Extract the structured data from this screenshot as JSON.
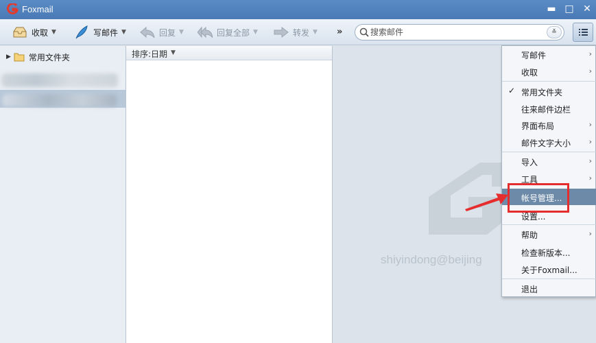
{
  "window": {
    "title": "Foxmail",
    "minimize": "▬",
    "maximize": "□",
    "close": "✕"
  },
  "toolbar": {
    "receive": {
      "label": "收取",
      "icon": "inbox-tray-icon"
    },
    "compose": {
      "label": "写邮件",
      "icon": "feather-pen-icon"
    },
    "reply": {
      "label": "回复",
      "icon": "reply-arrow-icon",
      "enabled": false
    },
    "reply_all": {
      "label": "回复全部",
      "icon": "reply-all-arrow-icon",
      "enabled": false
    },
    "forward": {
      "label": "转发",
      "icon": "forward-arrow-icon",
      "enabled": false
    },
    "more": "»",
    "caret": "▼"
  },
  "search": {
    "placeholder": "搜索邮件",
    "dropdown": "≚"
  },
  "folders": {
    "favorites": {
      "label": "常用文件夹",
      "arrow": "▶"
    }
  },
  "mail_list": {
    "sort_label": "排序:日期",
    "sort_caret": "▼"
  },
  "reading_pane": {
    "account_email": "shiyindong@beijing"
  },
  "menu": {
    "items": [
      {
        "label": "写邮件",
        "submenu": "›"
      },
      {
        "label": "收取",
        "submenu": "›"
      },
      {
        "label": "常用文件夹",
        "check": "✓"
      },
      {
        "label": "往来邮件边栏"
      },
      {
        "label": "界面布局",
        "submenu": "›"
      },
      {
        "label": "邮件文字大小",
        "submenu": "›"
      },
      {
        "label": "导入",
        "submenu": "›"
      },
      {
        "label": "工具",
        "submenu": "›"
      },
      {
        "label": "帐号管理..."
      },
      {
        "label": "设置..."
      },
      {
        "label": "帮助",
        "submenu": "›"
      },
      {
        "label": "检查新版本..."
      },
      {
        "label": "关于Foxmail..."
      },
      {
        "label": "退出"
      }
    ],
    "highlighted_index": 8
  },
  "colors": {
    "titlebar": "#4a7ab6",
    "highlight": "#6d8aa8",
    "annotation": "#e52d2d"
  }
}
